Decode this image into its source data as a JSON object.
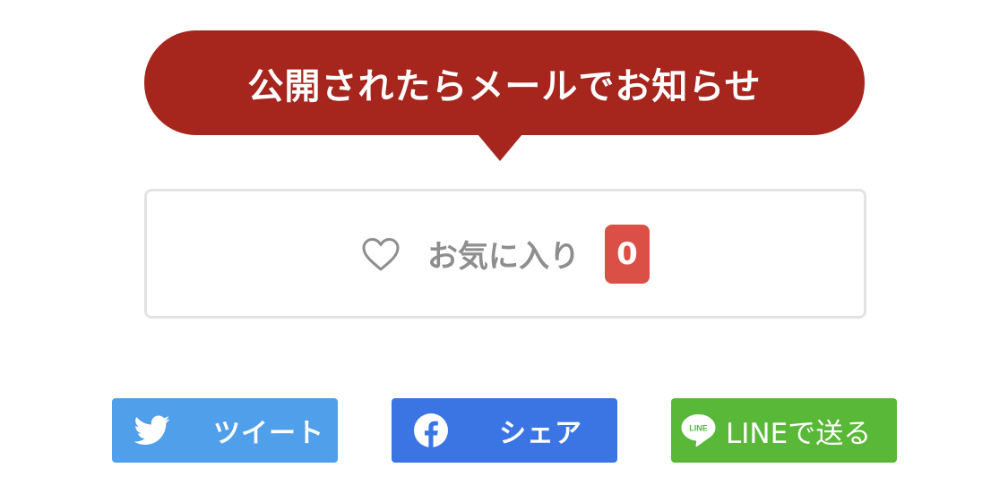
{
  "notify": {
    "label": "公開されたらメールでお知らせ",
    "color": "#a6251c"
  },
  "favorite": {
    "icon": "heart-outline-icon",
    "label": "お気に入り",
    "count": "0",
    "badge_color": "#db5046"
  },
  "share": {
    "twitter": {
      "icon": "twitter-bird-icon",
      "label": "ツイート",
      "color": "#4f9fea"
    },
    "facebook": {
      "icon": "facebook-icon",
      "label": "シェア",
      "color": "#3a75e3"
    },
    "line": {
      "icon": "line-icon",
      "icon_text": "LINE",
      "label": "LINEで送る",
      "color": "#59b838"
    }
  }
}
